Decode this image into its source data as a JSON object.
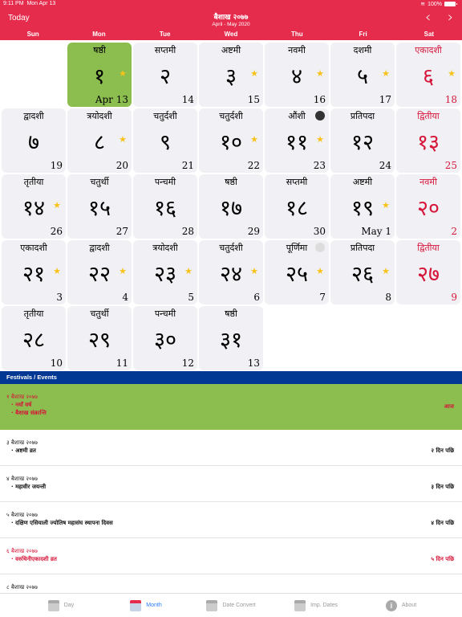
{
  "status_bar": {
    "time": "9:11 PM",
    "date": "Mon Apr 13",
    "battery": "100%"
  },
  "header": {
    "today_label": "Today",
    "title": "बैशाख २०७७",
    "subtitle": "April - May 2020",
    "prev_icon": "‹",
    "next_icon": "›",
    "accent_color": "#e52c4d"
  },
  "weekdays": [
    "Sun",
    "Mon",
    "Tue",
    "Wed",
    "Thu",
    "Fri",
    "Sat"
  ],
  "leading_empty": 1,
  "days": [
    {
      "tithi": "षष्ठी",
      "np": "१",
      "en": "Apr 13",
      "star": true,
      "today": true
    },
    {
      "tithi": "सप्तमी",
      "np": "२",
      "en": "14"
    },
    {
      "tithi": "अष्टमी",
      "np": "३",
      "en": "15",
      "star": true
    },
    {
      "tithi": "नवमी",
      "np": "४",
      "en": "16",
      "star": true
    },
    {
      "tithi": "दशमी",
      "np": "५",
      "en": "17",
      "star": true
    },
    {
      "tithi": "एकादशी",
      "np": "६",
      "en": "18",
      "star": true,
      "holiday": true
    },
    {
      "tithi": "द्वादशी",
      "np": "७",
      "en": "19"
    },
    {
      "tithi": "त्रयोदशी",
      "np": "८",
      "en": "20",
      "star": true
    },
    {
      "tithi": "चतुर्दशी",
      "np": "९",
      "en": "21"
    },
    {
      "tithi": "चतुर्दशी",
      "np": "१०",
      "en": "22",
      "star": true
    },
    {
      "tithi": "औंशी",
      "np": "११",
      "en": "23",
      "star": true,
      "moon": "new"
    },
    {
      "tithi": "प्रतिपदा",
      "np": "१२",
      "en": "24"
    },
    {
      "tithi": "द्वितीया",
      "np": "१३",
      "en": "25",
      "holiday": true
    },
    {
      "tithi": "तृतीया",
      "np": "१४",
      "en": "26",
      "star": true
    },
    {
      "tithi": "चतुर्थी",
      "np": "१५",
      "en": "27"
    },
    {
      "tithi": "पन्चमी",
      "np": "१६",
      "en": "28"
    },
    {
      "tithi": "षष्ठी",
      "np": "१७",
      "en": "29"
    },
    {
      "tithi": "सप्तमी",
      "np": "१८",
      "en": "30"
    },
    {
      "tithi": "अष्टमी",
      "np": "१९",
      "en": "May 1",
      "star": true
    },
    {
      "tithi": "नवमी",
      "np": "२०",
      "en": "2",
      "holiday": true
    },
    {
      "tithi": "एकादशी",
      "np": "२१",
      "en": "3",
      "star": true
    },
    {
      "tithi": "द्वादशी",
      "np": "२२",
      "en": "4",
      "star": true
    },
    {
      "tithi": "त्रयोदशी",
      "np": "२३",
      "en": "5",
      "star": true
    },
    {
      "tithi": "चतुर्दशी",
      "np": "२४",
      "en": "6",
      "star": true
    },
    {
      "tithi": "पूर्णिमा",
      "np": "२५",
      "en": "7",
      "star": true,
      "moon": "full"
    },
    {
      "tithi": "प्रतिपदा",
      "np": "२६",
      "en": "8",
      "star": true
    },
    {
      "tithi": "द्वितीया",
      "np": "२७",
      "en": "9",
      "holiday": true
    },
    {
      "tithi": "तृतीया",
      "np": "२८",
      "en": "10"
    },
    {
      "tithi": "चतुर्थी",
      "np": "२९",
      "en": "11"
    },
    {
      "tithi": "पन्चमी",
      "np": "३०",
      "en": "12"
    },
    {
      "tithi": "षष्ठी",
      "np": "३१",
      "en": "13"
    }
  ],
  "events_header": "Festivals / Events",
  "events": [
    {
      "date": "१ बैशाख २०७७",
      "items": [
        "नयाँ वर्ष",
        "बैशाख संक्रान्ति"
      ],
      "relative": "आज",
      "red": true,
      "today": true
    },
    {
      "date": "३ बैशाख २०७७",
      "items": [
        "अष्टमी व्रत"
      ],
      "relative": "२ दिन पछि"
    },
    {
      "date": "४ बैशाख २०७७",
      "items": [
        "महावीर जयन्ती"
      ],
      "relative": "३ दिन पछि"
    },
    {
      "date": "५ बैशाख २०७७",
      "items": [
        "दक्षिण एसियाली ज्योतिष महासंघ स्थापना दिवस"
      ],
      "relative": "४ दिन पछि"
    },
    {
      "date": "६ बैशाख २०७७",
      "items": [
        "वरुथिनीएकादशी व्रत"
      ],
      "relative": "५ दिन पछि",
      "red": true
    },
    {
      "date": "८ बैशाख २०७७",
      "items": [],
      "relative": ""
    }
  ],
  "tabs": [
    {
      "label": "Day",
      "icon": "day-calendar-icon"
    },
    {
      "label": "Month",
      "icon": "month-calendar-icon",
      "active": true
    },
    {
      "label": "Date Convert",
      "icon": "date-convert-icon"
    },
    {
      "label": "Imp. Dates",
      "icon": "important-dates-icon"
    },
    {
      "label": "About",
      "icon": "info-icon"
    }
  ]
}
